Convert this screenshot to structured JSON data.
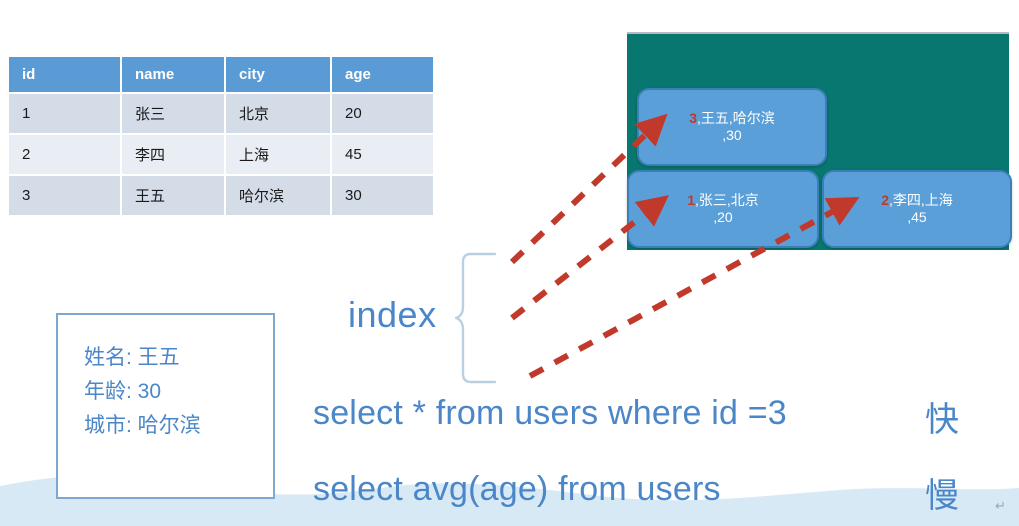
{
  "table": {
    "name": "users-table",
    "headers": [
      "id",
      "name",
      "city",
      "age"
    ],
    "header_bg": "#5b9bd5",
    "rows": [
      [
        "1",
        "张三",
        "北京",
        "20"
      ],
      [
        "2",
        "李四",
        "上海",
        "45"
      ],
      [
        "3",
        "王五",
        "哈尔滨",
        "30"
      ]
    ]
  },
  "tree": {
    "panel_color": "#07776f",
    "node_color": "#5b9fd8",
    "key_color": "#c0392b",
    "nodes": [
      {
        "id": "root",
        "key": "3",
        "rest": ",王五,哈尔滨",
        "rest2": ",30"
      },
      {
        "id": "left",
        "key": "1",
        "rest": ",张三,北京",
        "rest2": ",20"
      },
      {
        "id": "right",
        "key": "2",
        "rest": ",李四,上海",
        "rest2": ",45"
      }
    ]
  },
  "index": {
    "label": "index",
    "label_color": "#4a86c8",
    "arrow_color": "#c0392b",
    "arrow_count": 3
  },
  "record_card": {
    "border_color": "#7fa8cf",
    "lines": [
      "姓名: 王五",
      "年龄: 30",
      "城市: 哈尔滨"
    ]
  },
  "sql": {
    "text_color": "#4a86c8",
    "statements": [
      {
        "query": "select * from users where id =3",
        "speed": "快"
      },
      {
        "query": "select avg(age) from users",
        "speed": "慢"
      }
    ]
  },
  "misc": {
    "return_mark": "↵",
    "wave_color": "#d6e8f5"
  }
}
